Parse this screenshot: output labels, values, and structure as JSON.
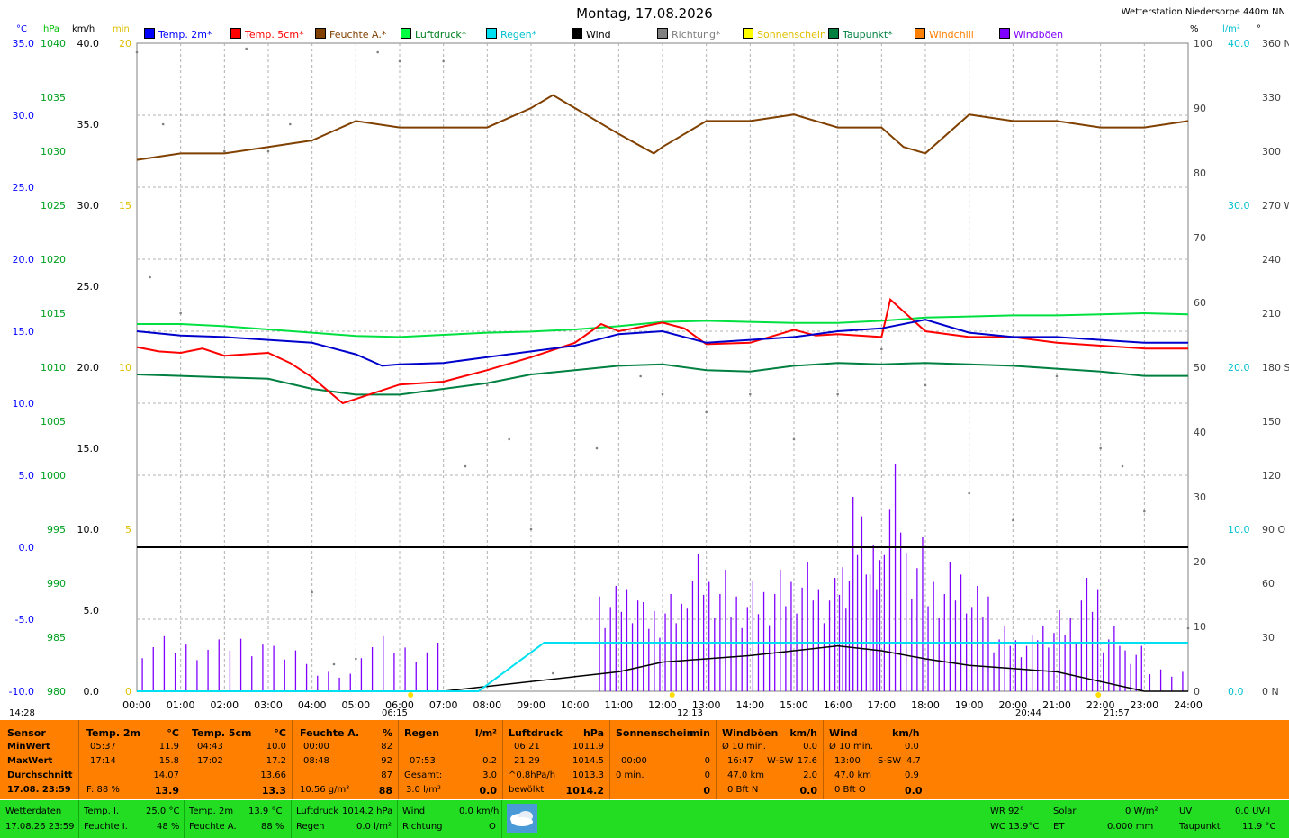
{
  "header": {
    "title": "Montag, 17.08.2026",
    "station": "Wetterstation Niedersorpe 440m NN"
  },
  "units": {
    "celsius": "°C",
    "hpa": "hPa",
    "kmh": "km/h",
    "min": "min",
    "percent": "%",
    "lm2": "l/m²",
    "deg": "°"
  },
  "legend": [
    {
      "label": "Temp. 2m*",
      "color": "#0000ff"
    },
    {
      "label": "Temp. 5cm*",
      "color": "#ff0000"
    },
    {
      "label": "Feuchte A.*",
      "color": "#804000"
    },
    {
      "label": "Luftdruck*",
      "color": "#00ff40"
    },
    {
      "label": "Regen*",
      "color": "#00e0f0"
    },
    {
      "label": "Wind",
      "color": "#000000"
    },
    {
      "label": "Richtung*",
      "color": "#808080"
    },
    {
      "label": "Sonnenschein",
      "color": "#ffff00"
    },
    {
      "label": "Taupunkt*",
      "color": "#008040"
    },
    {
      "label": "Windchill",
      "color": "#ff8000"
    },
    {
      "label": "Windböen",
      "color": "#8000ff"
    }
  ],
  "axis_ticks": {
    "temp": [
      "35.0",
      "30.0",
      "25.0",
      "20.0",
      "15.0",
      "10.0",
      "5.0",
      "0.0",
      "-5.0",
      "-10.0"
    ],
    "hpa": [
      "1040",
      "1035",
      "1030",
      "1025",
      "1020",
      "1015",
      "1010",
      "1005",
      "1000",
      "995",
      "990",
      "985",
      "980"
    ],
    "kmh": [
      "40.0",
      "35.0",
      "30.0",
      "25.0",
      "20.0",
      "15.0",
      "10.0",
      "5.0",
      "0.0"
    ],
    "min": [
      "20",
      "15",
      "10",
      "5",
      "0"
    ],
    "percent": [
      "100",
      "90",
      "80",
      "70",
      "60",
      "50",
      "40",
      "30",
      "20",
      "10",
      "0"
    ],
    "rain": [
      "40.0",
      "30.0",
      "20.0",
      "10.0",
      "0.0"
    ],
    "dir": [
      "360 N",
      "330",
      "300",
      "270 W",
      "240",
      "210",
      "180 S",
      "150",
      "120",
      "90 O",
      "60",
      "30",
      "0 N"
    ],
    "time": [
      "00:00",
      "01:00",
      "02:00",
      "03:00",
      "04:00",
      "05:00",
      "06:00",
      "07:00",
      "08:00",
      "09:00",
      "10:00",
      "11:00",
      "12:00",
      "13:00",
      "14:00",
      "15:00",
      "16:00",
      "17:00",
      "18:00",
      "19:00",
      "20:00",
      "21:00",
      "22:00",
      "23:00",
      "24:00"
    ]
  },
  "sun_markers": {
    "moonrise": "14:28",
    "sunrise": "06:15",
    "noon": "12:13",
    "moonset": "20:44",
    "sunset": "21:57"
  },
  "chart_data": {
    "type": "line",
    "x_unit": "hour",
    "xlim": [
      0,
      24
    ],
    "series": [
      {
        "name": "Temp. 2m*",
        "unit": "°C",
        "x": [
          0,
          1,
          2,
          3,
          4,
          5,
          5.6,
          6,
          7,
          8,
          9,
          10,
          11,
          12,
          13,
          14,
          15,
          16,
          17,
          18,
          19,
          20,
          21,
          22,
          23,
          24
        ],
        "values": [
          15.0,
          14.7,
          14.6,
          14.4,
          14.2,
          13.4,
          12.6,
          12.7,
          12.8,
          13.2,
          13.6,
          14.0,
          14.8,
          15.0,
          14.2,
          14.4,
          14.6,
          15.0,
          15.2,
          15.8,
          14.9,
          14.6,
          14.6,
          14.4,
          14.2,
          14.2
        ]
      },
      {
        "name": "Temp. 5cm*",
        "unit": "°C",
        "x": [
          0,
          0.5,
          1,
          1.5,
          2,
          3,
          3.5,
          4,
          4.7,
          5,
          6,
          7,
          8,
          9,
          10,
          10.6,
          11,
          12,
          12.5,
          13,
          14,
          15,
          15.5,
          16,
          17,
          17.2,
          18,
          19,
          20,
          21,
          22,
          23,
          24
        ],
        "values": [
          13.9,
          13.6,
          13.5,
          13.8,
          13.3,
          13.5,
          12.8,
          11.8,
          10.0,
          10.3,
          11.3,
          11.5,
          12.3,
          13.2,
          14.2,
          15.5,
          15.0,
          15.6,
          15.2,
          14.1,
          14.2,
          15.1,
          14.7,
          14.8,
          14.6,
          17.2,
          15.0,
          14.6,
          14.6,
          14.2,
          14.0,
          13.8,
          13.8
        ]
      },
      {
        "name": "Feuchte A.*",
        "unit": "%",
        "x": [
          0,
          1,
          2,
          3,
          4,
          5,
          6,
          7,
          8,
          9,
          9.5,
          10,
          11,
          11.8,
          12,
          13,
          14,
          15,
          16,
          17,
          17.5,
          18,
          19,
          20,
          21,
          22,
          23,
          24
        ],
        "values": [
          82,
          83,
          83,
          84,
          85,
          88,
          87,
          87,
          87,
          90,
          92,
          90,
          86,
          83,
          84,
          88,
          88,
          89,
          87,
          87,
          84,
          83,
          89,
          88,
          88,
          87,
          87,
          88
        ]
      },
      {
        "name": "Luftdruck*",
        "unit": "hPa",
        "x": [
          0,
          1,
          2,
          3,
          4,
          5,
          6,
          7,
          8,
          9,
          10,
          11,
          12,
          13,
          14,
          15,
          16,
          17,
          18,
          19,
          20,
          21,
          22,
          23,
          24
        ],
        "values": [
          1014.0,
          1014.0,
          1013.8,
          1013.5,
          1013.2,
          1012.9,
          1012.8,
          1013.0,
          1013.2,
          1013.3,
          1013.5,
          1013.8,
          1014.2,
          1014.3,
          1014.2,
          1014.1,
          1014.1,
          1014.3,
          1014.6,
          1014.7,
          1014.8,
          1014.8,
          1014.9,
          1015.0,
          1014.9
        ]
      },
      {
        "name": "Taupunkt*",
        "unit": "°C",
        "x": [
          0,
          1,
          2,
          3,
          4,
          5,
          6,
          7,
          8,
          9,
          10,
          11,
          12,
          13,
          14,
          15,
          16,
          17,
          18,
          19,
          20,
          21,
          22,
          23,
          24
        ],
        "values": [
          12.0,
          11.9,
          11.8,
          11.7,
          11.0,
          10.6,
          10.6,
          11.0,
          11.4,
          12.0,
          12.3,
          12.6,
          12.7,
          12.3,
          12.2,
          12.6,
          12.8,
          12.7,
          12.8,
          12.7,
          12.6,
          12.4,
          12.2,
          11.9,
          11.9
        ]
      },
      {
        "name": "Regen*",
        "unit": "l/m²",
        "x": [
          0,
          7.8,
          8.2,
          8.6,
          9,
          9.3,
          10,
          12.5,
          13,
          24
        ],
        "values": [
          0,
          0,
          0.8,
          1.6,
          2.4,
          3.0,
          3.0,
          3.0,
          3.0,
          3.0
        ]
      },
      {
        "name": "Wind",
        "unit": "km/h",
        "x": [
          0,
          6,
          7,
          10,
          11,
          11.5,
          12,
          13,
          14,
          16,
          17,
          18,
          19,
          20,
          21,
          22,
          23,
          24
        ],
        "values": [
          0,
          0,
          0,
          0.9,
          1.2,
          1.5,
          1.8,
          2.0,
          2.2,
          2.8,
          2.5,
          2.0,
          1.6,
          1.4,
          1.2,
          0.6,
          0,
          0
        ]
      },
      {
        "name": "Windböen",
        "unit": "km/h",
        "x": [
          0,
          1,
          2,
          3,
          4,
          5,
          6,
          7,
          8,
          9,
          10,
          10.5,
          11,
          11.5,
          12,
          12.5,
          13,
          13.5,
          14,
          14.5,
          15,
          15.5,
          16,
          16.3,
          16.7,
          17,
          17.5,
          18,
          18.5,
          19,
          19.5,
          20,
          20.5,
          21,
          21.5,
          22,
          22.5,
          23,
          24
        ],
        "values": [
          3.4,
          3.2,
          3.6,
          2.8,
          1.2,
          3.4,
          3.0,
          0,
          0,
          0,
          0,
          6.5,
          7.0,
          5.5,
          6.0,
          8.5,
          7.5,
          6.5,
          6.8,
          7.5,
          8.0,
          7.0,
          8.5,
          12.0,
          9.0,
          14.0,
          9.5,
          7.5,
          8.0,
          6.5,
          4.0,
          3.5,
          4.5,
          5.0,
          7.0,
          4.0,
          2.8,
          1.5,
          0
        ]
      },
      {
        "name": "Richtung*",
        "unit": "°",
        "x": [
          0,
          0.3,
          0.6,
          1,
          2,
          2.5,
          3,
          3.5,
          4,
          4.5,
          5,
          5.5,
          6,
          7,
          7.5,
          8,
          8.5,
          9,
          9.5,
          10,
          10.5,
          11,
          11.5,
          12,
          13,
          14,
          15,
          16,
          17,
          18,
          19,
          20,
          21,
          22,
          22.5,
          23,
          24
        ],
        "values": [
          355,
          230,
          315,
          210,
          300,
          357,
          300,
          315,
          55,
          15,
          18,
          355,
          350,
          350,
          125,
          170,
          140,
          90,
          10,
          80,
          135,
          200,
          175,
          165,
          155,
          165,
          140,
          165,
          190,
          170,
          110,
          95,
          175,
          135,
          125,
          100,
          35
        ]
      }
    ]
  },
  "panel": {
    "sensor": {
      "h1": "Sensor",
      "rows": [
        "MinWert",
        "MaxWert",
        "Durchschnitt",
        "17.08. 23:59"
      ]
    },
    "temp2m": {
      "h1": "Temp. 2m",
      "h2": "°C",
      "min_t": "05:37",
      "min_v": "11.9",
      "max_t": "17:14",
      "max_v": "15.8",
      "avg": "14.07",
      "f_label": "F: 88 %",
      "cur": "13.9"
    },
    "temp5cm": {
      "h1": "Temp. 5cm",
      "h2": "°C",
      "min_t": "04:43",
      "min_v": "10.0",
      "max_t": "17:02",
      "max_v": "17.2",
      "avg": "13.66",
      "cur": "13.3"
    },
    "feuchte": {
      "h1": "Feuchte A.",
      "h2": "%",
      "min_t": "00:00",
      "min_v": "82",
      "max_t": "08:48",
      "max_v": "92",
      "avg": "87",
      "abs": "10.56 g/m³",
      "cur": "88"
    },
    "regen": {
      "h1": "Regen",
      "h2": "l/m²",
      "t1": "07:53",
      "v1": "0.2",
      "g_label": "Gesamt:",
      "g_v": "3.0",
      "rate": "3.0 l/m²",
      "cur": "0.0"
    },
    "luftdruck": {
      "h1": "Luftdruck",
      "h2": "hPa",
      "min_t": "06:21",
      "min_v": "1011.9",
      "max_t": "21:29",
      "max_v": "1014.5",
      "trend_l": "^0.8hPa/h",
      "trend_v": "1013.3",
      "state": "bewölkt",
      "cur": "1014.2"
    },
    "sonne": {
      "h1": "Sonnenschein",
      "h2": "min",
      "t1": "00:00",
      "v1": "0",
      "l2": "0 min.",
      "v2": "0",
      "cur": "0"
    },
    "boeen": {
      "h1": "Windböen",
      "h2": "km/h",
      "r1l": "Ø 10 min.",
      "r1v": "0.0",
      "r2t": "16:47",
      "r2d": "W-SW",
      "r2v": "17.6",
      "r3l": "47.0 km",
      "r3v": "2.0",
      "r4l": "0 Bft N",
      "cur": "0.0"
    },
    "wind": {
      "h1": "Wind",
      "h2": "km/h",
      "r1l": "Ø 10 min.",
      "r1v": "0.0",
      "r2t": "13:00",
      "r2d": "S-SW",
      "r2v": "4.7",
      "r3l": "47.0 km",
      "r3v": "0.9",
      "r4l": "0 Bft O",
      "cur": "0.0"
    }
  },
  "bottom": {
    "label": "Wetterdaten",
    "datetime": "17.08.26 23:59",
    "ti_l": "Temp. I.",
    "ti_v": "25.0 °C",
    "fi_l": "Feuchte I.",
    "fi_v": "48 %",
    "t2_l": "Temp. 2m",
    "t2_v": "13.9 °C",
    "fa_l": "Feuchte A.",
    "fa_v": "88 %",
    "ld_l": "Luftdruck",
    "ld_v": "1014.2 hPa",
    "rg_l": "Regen",
    "rg_v": "0.0 l/m²",
    "wd_l": "Wind",
    "wd_v": "0.0 km/h",
    "ri_l": "Richtung",
    "ri_v": "O",
    "wr": "WR 92°",
    "wc": "WC 13.9°C",
    "solar_l": "Solar",
    "solar_v": "0 W/m²",
    "et_l": "ET",
    "et_v": "0.000 mm",
    "uv_l": "UV",
    "uv_v": "0.0 UV-I",
    "tp_l": "Taupunkt",
    "tp_v": "11.9 °C"
  }
}
